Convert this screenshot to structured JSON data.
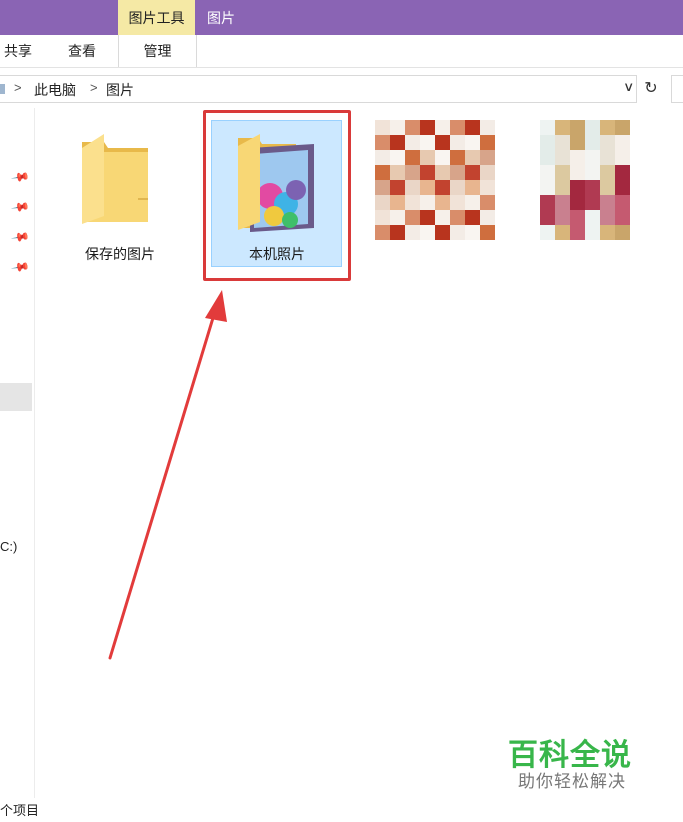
{
  "ribbon": {
    "context_tab": "图片工具",
    "context_title": "图片",
    "tabs": [
      {
        "label": "共享"
      },
      {
        "label": "查看"
      },
      {
        "label": "管理"
      }
    ]
  },
  "address": {
    "crumbs": [
      "此电脑",
      "图片"
    ],
    "separator": ">"
  },
  "nav": {
    "drive_label": "C:)"
  },
  "files": [
    {
      "name": "保存的图片",
      "icon": "folder-icon",
      "selected": false
    },
    {
      "name": "本机照片",
      "icon": "photo-folder-icon",
      "selected": true
    },
    {
      "name": "",
      "icon": "pixelated-image-thumbnail",
      "selected": false
    },
    {
      "name": "",
      "icon": "pixelated-image-thumbnail",
      "selected": false
    }
  ],
  "status": {
    "count_text": "个项目"
  },
  "watermark": {
    "title": "百科全说",
    "subtitle": "助你轻松解决"
  },
  "colors": {
    "titlebar": "#8a64b4",
    "context_tab": "#f5e9a5",
    "selection": "#cce8ff",
    "highlight_box": "#d93a3a",
    "arrow": "#e23b3b",
    "watermark_green": "#38b64a"
  }
}
